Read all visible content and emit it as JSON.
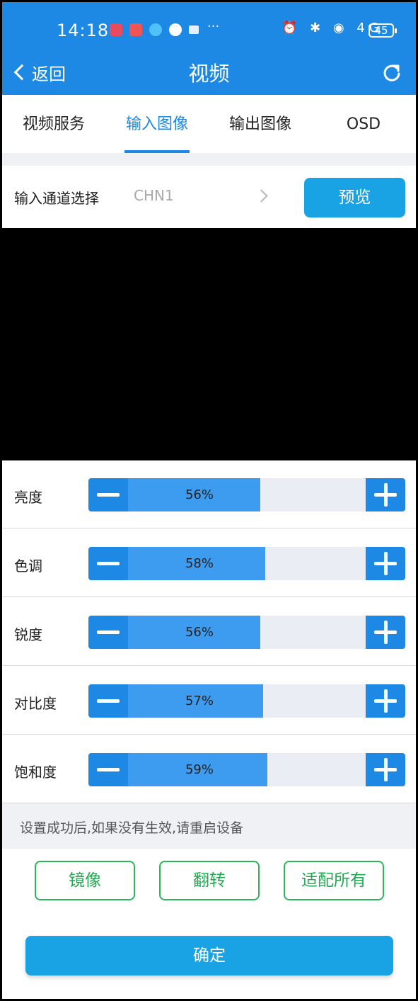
{
  "status_bar": {
    "time": "14:18",
    "more": "···",
    "signal_icons": "⏰ ✱ ◉ 4G",
    "battery": "45"
  },
  "app_bar": {
    "back_label": "返回",
    "title": "视频"
  },
  "tabs": [
    {
      "label": "视频服务",
      "active": false
    },
    {
      "label": "输入图像",
      "active": true
    },
    {
      "label": "输出图像",
      "active": false
    },
    {
      "label": "OSD",
      "active": false
    }
  ],
  "channel": {
    "label": "输入通道选择",
    "value": "CHN1",
    "preview_label": "预览"
  },
  "sliders": [
    {
      "label": "亮度",
      "value": 56,
      "display": "56%"
    },
    {
      "label": "色调",
      "value": 58,
      "display": "58%"
    },
    {
      "label": "锐度",
      "value": 56,
      "display": "56%"
    },
    {
      "label": "对比度",
      "value": 57,
      "display": "57%"
    },
    {
      "label": "饱和度",
      "value": 59,
      "display": "59%"
    }
  ],
  "notice": "设置成功后,如果没有生效,请重启设备",
  "actions": {
    "mirror": "镜像",
    "flip": "翻转",
    "fit_all": "适配所有"
  },
  "confirm_label": "确定",
  "colors": {
    "primary": "#1e88e5",
    "button_blue": "#1aa3e4",
    "slider_fill": "#3d9bf0",
    "green_outline": "#2cb65a"
  }
}
